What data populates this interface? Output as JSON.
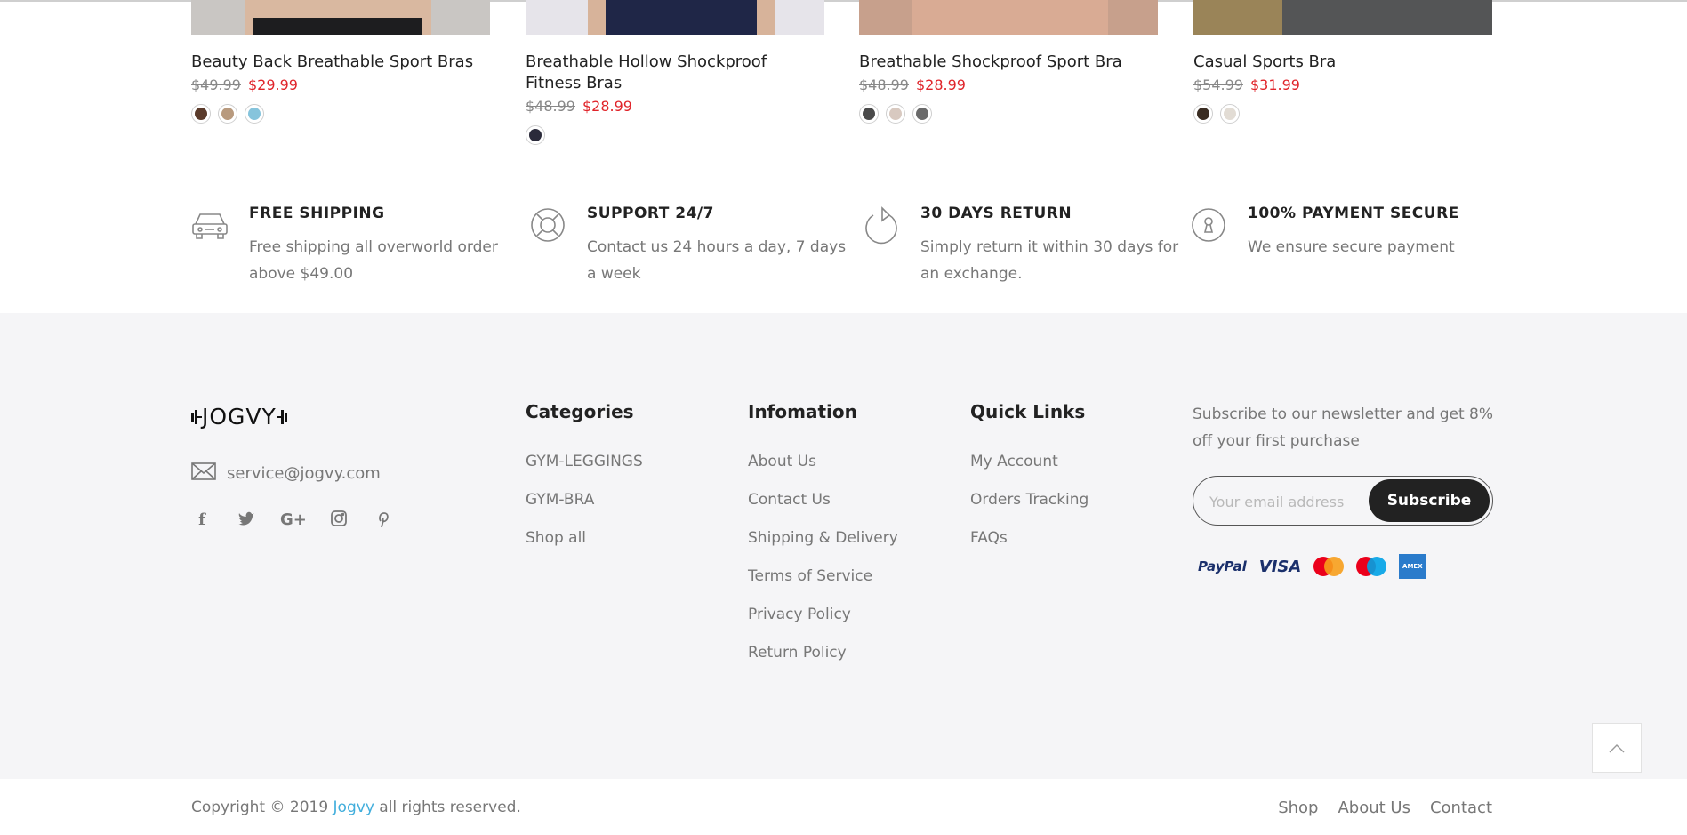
{
  "products": [
    {
      "title": "Beauty Back Breathable Sport Bras",
      "price_old": "$49.99",
      "price_new": "$29.99",
      "swatches": [
        "#5a3a2a",
        "#b89a7e",
        "#86c4dc"
      ]
    },
    {
      "title": "Breathable Hollow Shockproof Fitness Bras",
      "price_old": "$48.99",
      "price_new": "$28.99",
      "swatches": [
        "#2a2a3a"
      ]
    },
    {
      "title": "Breathable Shockproof Sport Bra",
      "price_old": "$48.99",
      "price_new": "$28.99",
      "swatches": [
        "#4a4a4a",
        "#d8c9c0",
        "#6a6a6a"
      ]
    },
    {
      "title": "Casual Sports Bra",
      "price_old": "$54.99",
      "price_new": "$31.99",
      "swatches": [
        "#3a2c22",
        "#e2dcd4"
      ]
    }
  ],
  "features": [
    {
      "icon": "car-icon",
      "title": "FREE SHIPPING",
      "desc": "Free shipping all overworld order above $49.00"
    },
    {
      "icon": "lifebuoy-icon",
      "title": "SUPPORT 24/7",
      "desc": "Contact us 24 hours a day, 7 days a week"
    },
    {
      "icon": "return-icon",
      "title": "30 DAYS RETURN",
      "desc": "Simply return it within 30 days for an exchange."
    },
    {
      "icon": "lock-icon",
      "title": "100% PAYMENT SECURE",
      "desc": "We ensure secure payment"
    }
  ],
  "footer": {
    "logo": "JOGVY",
    "email": "service@jogvy.com",
    "social": [
      "facebook-icon",
      "twitter-icon",
      "google-plus-icon",
      "instagram-icon",
      "pinterest-icon"
    ],
    "categories": {
      "title": "Categories",
      "items": [
        "GYM-LEGGINGS",
        "GYM-BRA",
        "Shop all"
      ]
    },
    "information": {
      "title": "Infomation",
      "items": [
        "About Us",
        "Contact Us",
        "Shipping & Delivery",
        "Terms of Service",
        "Privacy Policy",
        "Return Policy"
      ]
    },
    "quick_links": {
      "title": "Quick Links",
      "items": [
        "My Account",
        "Orders Tracking",
        "FAQs"
      ]
    },
    "newsletter": {
      "text": "Subscribe to our newsletter and get 8% off your first purchase",
      "placeholder": "Your email address",
      "button": "Subscribe"
    },
    "payments": [
      "PayPal",
      "VISA",
      "mastercard",
      "maestro",
      "AMERICAN EXPRESS"
    ]
  },
  "bottom": {
    "copyright_prefix": "Copyright © 2019",
    "brand": "Jogvy",
    "copyright_suffix": "all rights reserved.",
    "nav": [
      "Shop",
      "About Us",
      "Contact"
    ]
  }
}
